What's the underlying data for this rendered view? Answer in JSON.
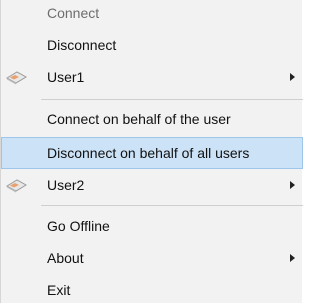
{
  "menu": {
    "items": [
      {
        "label": "Connect",
        "disabled": true
      },
      {
        "label": "Disconnect"
      },
      {
        "label": "User1",
        "icon": "user-card-icon",
        "submenu": true
      },
      {
        "label": "Connect on behalf of the user"
      },
      {
        "label": "Disconnect on behalf of all users",
        "highlighted": true
      },
      {
        "label": "User2",
        "icon": "user-card-icon",
        "submenu": true
      },
      {
        "label": "Go Offline"
      },
      {
        "label": "About",
        "submenu": true
      },
      {
        "label": "Exit"
      }
    ],
    "colors": {
      "background": "#f2f2f2",
      "highlight_fill": "#cce3f7",
      "highlight_border": "#9cc6ea",
      "disabled_text": "#6d6d6d",
      "text": "#111111"
    }
  }
}
